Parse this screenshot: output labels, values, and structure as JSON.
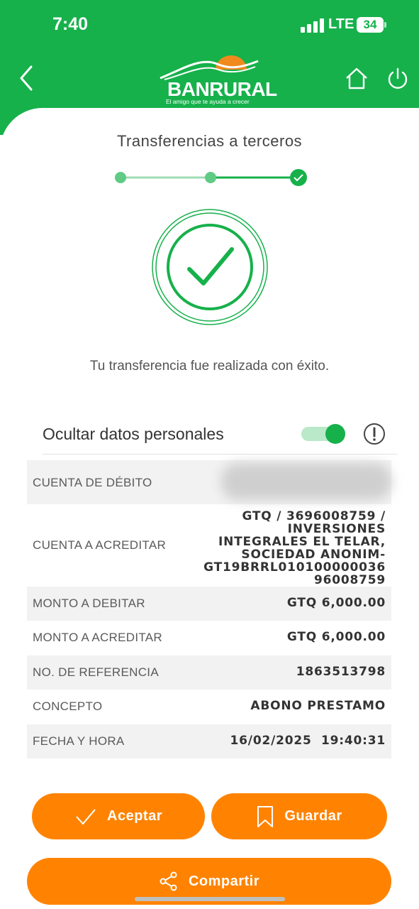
{
  "status_bar": {
    "time": "7:40",
    "network": "LTE",
    "battery": "34"
  },
  "brand": {
    "name": "BANRURAL",
    "tagline": "El amigo que te ayuda a crecer"
  },
  "page": {
    "title": "Transferencias a terceros",
    "success_message": "Tu transferencia fue realizada con éxito."
  },
  "stepper": {
    "steps": 3,
    "current": 3
  },
  "privacy": {
    "label": "Ocultar datos personales",
    "enabled": true
  },
  "details": [
    {
      "label": "CUENTA DE DÉBITO",
      "value": ""
    },
    {
      "label": "CUENTA A ACREDITAR",
      "value_lines": [
        "GTQ / 3696008759 /",
        "INVERSIONES",
        "INTEGRALES EL TELAR,",
        "SOCIEDAD ANONIM-",
        "GT19BRRL010100000036",
        "96008759"
      ]
    },
    {
      "label": "MONTO A DEBITAR",
      "value": "GTQ 6,000.00"
    },
    {
      "label": "MONTO A ACREDITAR",
      "value": "GTQ 6,000.00"
    },
    {
      "label": "NO. DE REFERENCIA",
      "value": "1863513798"
    },
    {
      "label": "CONCEPTO",
      "value": "ABONO PRESTAMO"
    },
    {
      "label": "FECHA Y HORA",
      "value": "16/02/2025  19:40:31"
    }
  ],
  "buttons": {
    "accept": "Aceptar",
    "save": "Guardar",
    "share": "Compartir"
  },
  "colors": {
    "brand_green": "#16b14b",
    "accent_orange": "#ff8300"
  }
}
